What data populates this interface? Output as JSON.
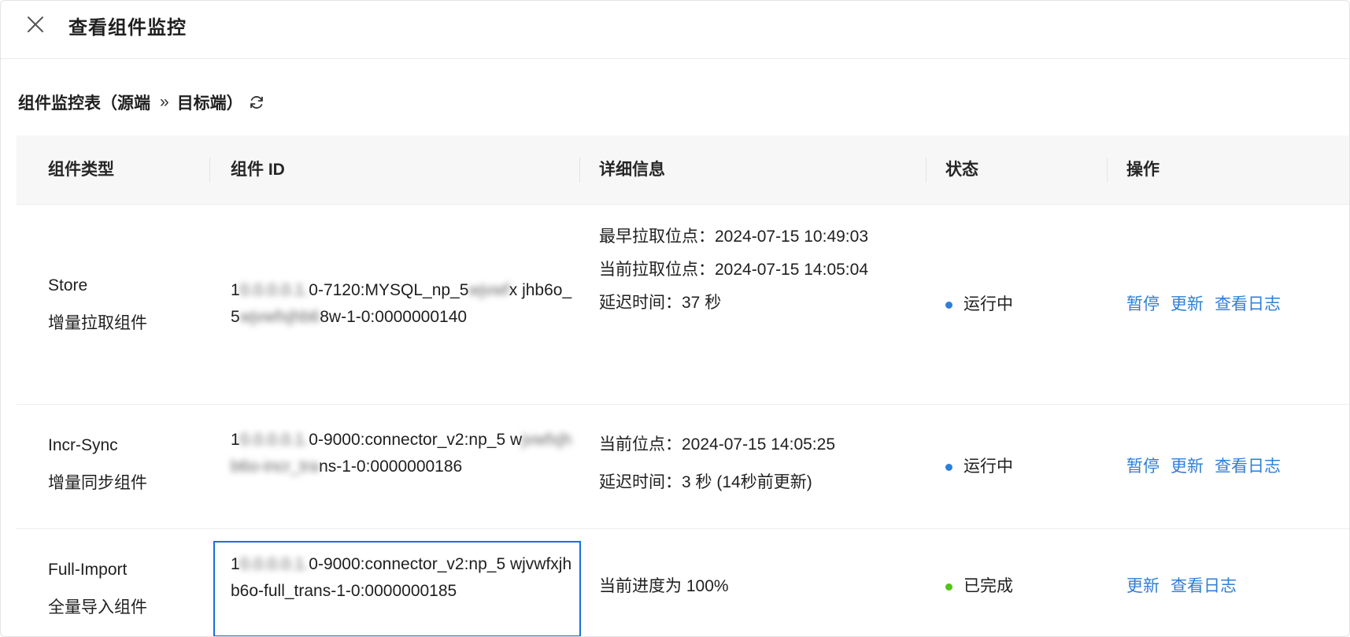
{
  "header": {
    "title": "查看组件监控",
    "close_icon": "close-icon"
  },
  "section": {
    "title_left": "组件监控表（源端",
    "arrow": "»",
    "title_right": "目标端）",
    "refresh_icon": "refresh-icon"
  },
  "table": {
    "columns": [
      "组件类型",
      "组件 ID",
      "详细信息",
      "状态",
      "操作"
    ],
    "rows": [
      {
        "type_en": "Store",
        "type_cn": "增量拉取组件",
        "id_pre": "1",
        "id_blur1": "0.0.0.0.1.",
        "id_mid": "0-7120:MYSQL_np_5",
        "id_blur2": "wjvwf",
        "id_mid2": "x jhb6o_5",
        "id_blur3": "wjvwfxjhb6",
        "id_post": "8w-1-0:0000000140",
        "details": [
          "最早拉取位点：2024-07-15 10:49:03",
          "当前拉取位点：2024-07-15 14:05:04",
          "延迟时间：37 秒"
        ],
        "status": "运行中",
        "status_color": "#2f7fd8",
        "actions": [
          "暂停",
          "更新",
          "查看日志"
        ]
      },
      {
        "type_en": "Incr-Sync",
        "type_cn": "增量同步组件",
        "id_pre": "1",
        "id_blur1": "0.0.0.0.1.",
        "id_mid": "0-9000:connector_v2:np_5 w",
        "id_blur2": "jvwfxjhb6o-incr_tra",
        "id_post": "ns-1-0:0000000186",
        "details": [
          "当前位点：2024-07-15 14:05:25",
          "延迟时间：3 秒 (14秒前更新)"
        ],
        "status": "运行中",
        "status_color": "#2f7fd8",
        "actions": [
          "暂停",
          "更新",
          "查看日志"
        ]
      },
      {
        "type_en": "Full-Import",
        "type_cn": "全量导入组件",
        "id_pre": "1",
        "id_blur1": "0.0.0.0.1.",
        "id_post": "0-9000:connector_v2:np_5 wjvwfxjhb6o-full_trans-1-0:0000000185",
        "details": [
          "当前进度为 100%"
        ],
        "status": "已完成",
        "status_color": "#52c41a",
        "actions": [
          "更新",
          "查看日志"
        ]
      }
    ]
  }
}
